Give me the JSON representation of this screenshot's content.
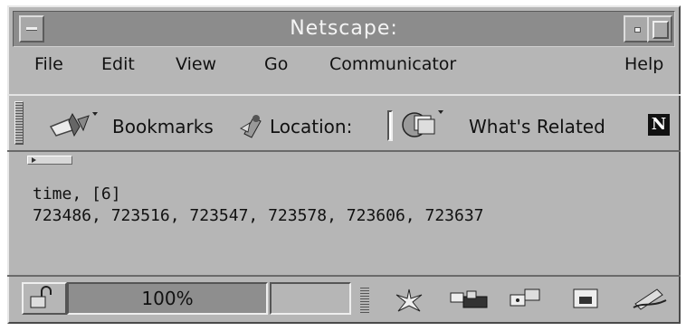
{
  "window": {
    "title": "Netscape:"
  },
  "menubar": {
    "items": [
      "File",
      "Edit",
      "View",
      "Go",
      "Communicator",
      "Help"
    ]
  },
  "toolbar": {
    "bookmarks_label": "Bookmarks",
    "location_label": "Location:",
    "related_label": "What's Related",
    "icons": [
      "bookmarks-icon",
      "location-icon",
      "whats-related-icon",
      "netscape-n-logo"
    ]
  },
  "content": {
    "line1": "time, [6]",
    "line2": "723486, 723516, 723547, 723578, 723606, 723637"
  },
  "status": {
    "zoom": "100%",
    "icons": [
      "security-lock-icon",
      "navigator-icon",
      "mail-icon",
      "discussions-icon",
      "composer-icon",
      "edit-pen-icon"
    ]
  },
  "colors": {
    "chrome": "#b6b6b6",
    "titlebar": "#8c8c8c",
    "progress": "#8e8e8e"
  }
}
